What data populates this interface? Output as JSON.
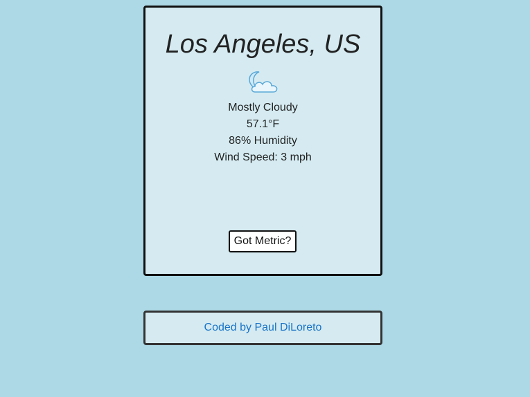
{
  "weather": {
    "city": "Los Angeles, US",
    "icon": "moon-cloud-icon",
    "description": "Mostly Cloudy",
    "temperature": "57.1°F",
    "humidity": "86% Humidity",
    "wind": "Wind Speed: 3 mph",
    "unit_button_label": "Got Metric?"
  },
  "footer": {
    "credit_link": "Coded by Paul DiLoreto"
  },
  "colors": {
    "background": "#add8e6",
    "card": "#d5ebf1",
    "link": "#1a73c7"
  }
}
